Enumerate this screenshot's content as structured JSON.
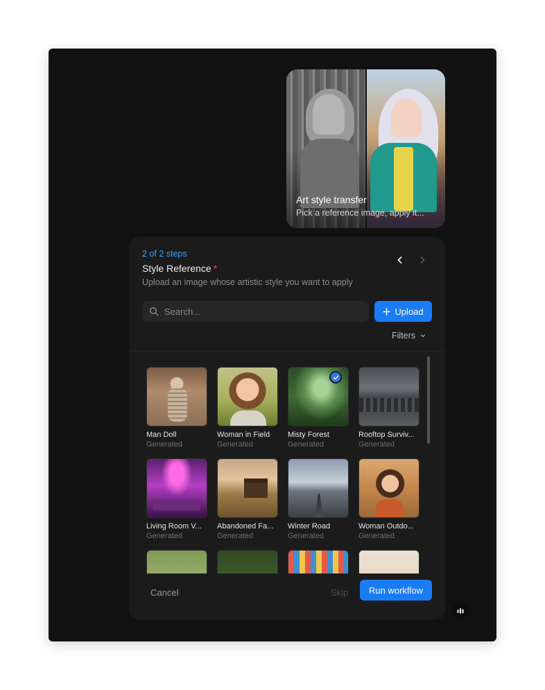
{
  "workflow": {
    "title": "Art style transfer",
    "subtitle": "Pick a reference image, apply it..."
  },
  "step": {
    "counter": "2 of 2 steps",
    "title": "Style Reference",
    "required_marker": "*",
    "description": "Upload an image whose artistic style you want to apply"
  },
  "search": {
    "placeholder": "Search..."
  },
  "upload": {
    "label": "Upload"
  },
  "filters": {
    "label": "Filters"
  },
  "gallery": {
    "items": [
      {
        "name": "Man Doll",
        "source": "Generated",
        "selected": true
      },
      {
        "name": "Woman in Field",
        "source": "Generated"
      },
      {
        "name": "Misty Forest",
        "source": "Generated"
      },
      {
        "name": "Rooftop Surviv...",
        "source": "Generated"
      },
      {
        "name": "Living Room V...",
        "source": "Generated"
      },
      {
        "name": "Abandoned Fa...",
        "source": "Generated"
      },
      {
        "name": "Winter Road",
        "source": "Generated"
      },
      {
        "name": "Woman Outdo...",
        "source": "Generated"
      }
    ]
  },
  "footer": {
    "cancel": "Cancel",
    "skip": "Skip",
    "run": "Run workflow"
  },
  "colors": {
    "accent": "#1a7cf5",
    "step_counter": "#3aa0ff",
    "required": "#ff4d4d",
    "panel_bg": "#1b1b1b",
    "frame_bg": "#111111"
  },
  "icons": {
    "nav_prev": "chevron-left-icon",
    "nav_next": "chevron-right-icon",
    "search": "search-icon",
    "upload": "plus-icon",
    "filters": "chevron-down-icon",
    "selected": "check-icon",
    "fab": "audio-bars-icon"
  }
}
